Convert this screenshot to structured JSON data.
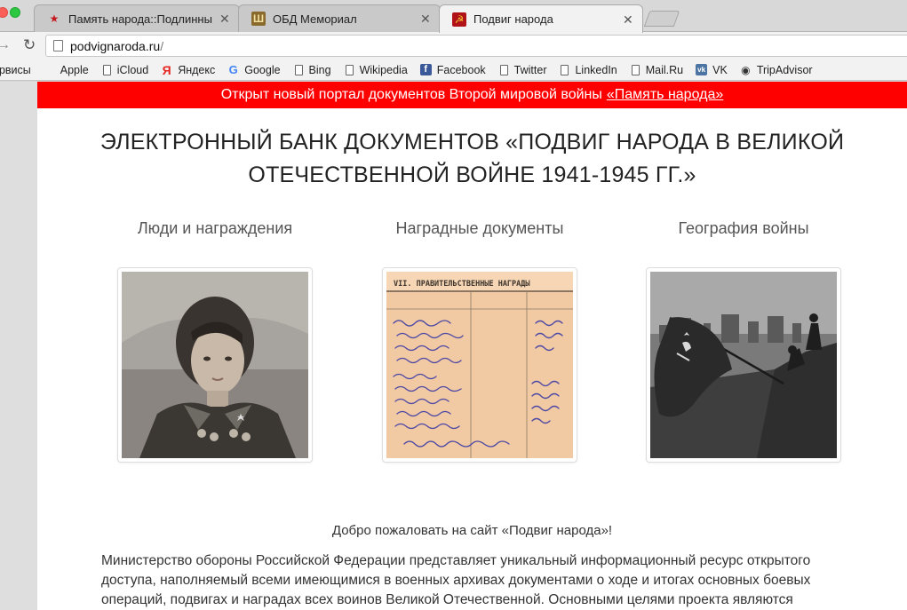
{
  "browser": {
    "tabs": [
      {
        "title": "Память народа::Подлинные д",
        "icon": "star-icon",
        "active": false
      },
      {
        "title": "ОБД Мемориал",
        "icon": "obd-memorial-icon",
        "active": false
      },
      {
        "title": "Подвиг народа",
        "icon": "podvig-naroda-icon",
        "active": true
      }
    ],
    "url_host": "podvignaroda.ru",
    "url_path": "/",
    "bookmarks": [
      {
        "label": "ервисы",
        "icon": "none"
      },
      {
        "label": "Apple",
        "icon": "apple-icon"
      },
      {
        "label": "iCloud",
        "icon": "page-icon"
      },
      {
        "label": "Яндекс",
        "icon": "yandex-icon"
      },
      {
        "label": "Google",
        "icon": "google-icon"
      },
      {
        "label": "Bing",
        "icon": "page-icon"
      },
      {
        "label": "Wikipedia",
        "icon": "page-icon"
      },
      {
        "label": "Facebook",
        "icon": "facebook-icon"
      },
      {
        "label": "Twitter",
        "icon": "page-icon"
      },
      {
        "label": "LinkedIn",
        "icon": "page-icon"
      },
      {
        "label": "Mail.Ru",
        "icon": "page-icon"
      },
      {
        "label": "VK",
        "icon": "vk-icon"
      },
      {
        "label": "TripAdvisor",
        "icon": "tripadvisor-icon"
      }
    ]
  },
  "banner": {
    "text": "Открыт новый портал документов Второй мировой войны",
    "link": "«Память народа»",
    "color": "#ff0000"
  },
  "page": {
    "title_line1": "ЭЛЕКТРОННЫЙ БАНК ДОКУМЕНТОВ «ПОДВИГ НАРОДА В ВЕЛИКОЙ",
    "title_line2": "ОТЕЧЕСТВЕННОЙ ВОЙНЕ 1941-1945 ГГ.»",
    "sections": [
      {
        "label": "Люди и награждения",
        "image": "woman-soldier-portrait"
      },
      {
        "label": "Наградные документы",
        "image": "award-document"
      },
      {
        "label": "География войны",
        "image": "reichstag-flag"
      }
    ],
    "welcome": "Добро пожаловать на сайт «Подвиг народа»!",
    "intro": "Министерство обороны Российской Федерации представляет уникальный информационный ресурс открытого доступа, наполняемый всеми имеющимися в военных архивах документами о ходе и итогах основных боевых операций, подвигах и наградах всех воинов Великой Отечественной. Основными целями проекта являются"
  }
}
